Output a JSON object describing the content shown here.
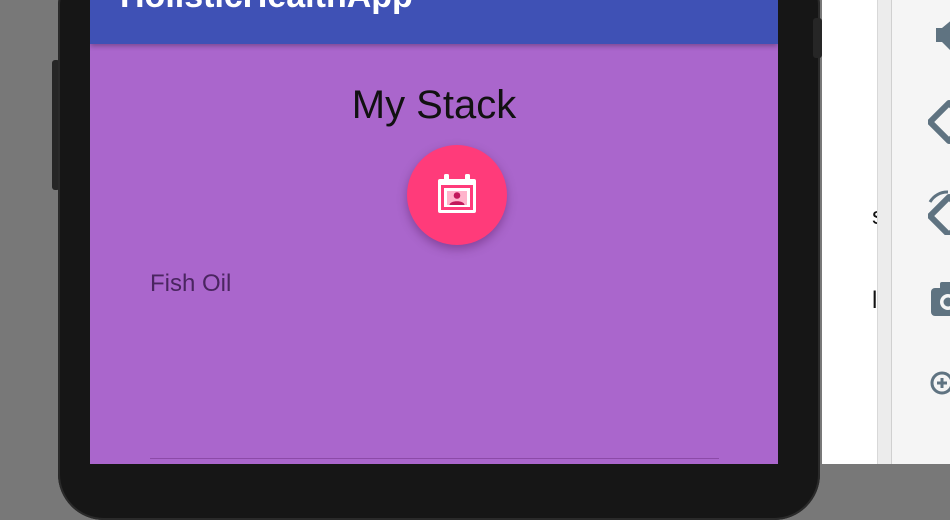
{
  "app_bar": {
    "title": "HolisticHealthApp"
  },
  "content": {
    "title": "My Stack"
  },
  "fab": {
    "icon": "calendar-contact-icon",
    "color": "#ff3b7a"
  },
  "stack_items": [
    {
      "label": "Fish Oil"
    }
  ],
  "side_panel": {
    "partial_labels": [
      "so",
      "le"
    ]
  },
  "toolbar": {
    "icons": [
      "volume-icon",
      "rotate-left-icon",
      "rotate-right-icon",
      "camera-icon",
      "zoom-in-icon"
    ]
  },
  "colors": {
    "app_bar": "#3f51b5",
    "background": "#aa66cc",
    "accent": "#ff3b7a",
    "toolbar_icon": "#5f7381"
  }
}
